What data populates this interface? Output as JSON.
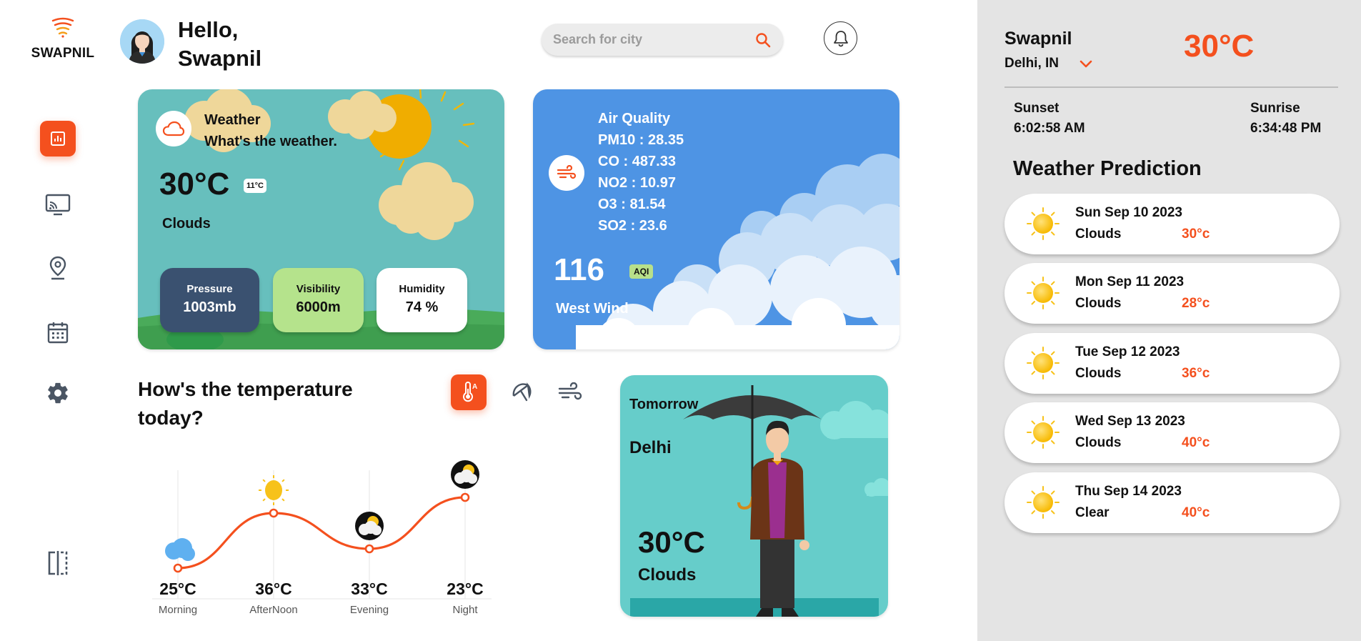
{
  "brand": {
    "name": "SWAPNIL"
  },
  "header": {
    "greeting_line1": "Hello,",
    "greeting_line2": "Swapnil",
    "search_placeholder": "Search for city"
  },
  "sidebar": {
    "items": [
      {
        "icon": "chart-icon",
        "active": true
      },
      {
        "icon": "cast-icon",
        "active": false
      },
      {
        "icon": "location-pin-icon",
        "active": false
      },
      {
        "icon": "calendar-icon",
        "active": false
      },
      {
        "icon": "gear-icon",
        "active": false
      }
    ],
    "bottom_icon": "split-panel-icon"
  },
  "weather_card": {
    "title": "Weather",
    "subtitle": "What's the weather.",
    "temp": "30°C",
    "min_temp": "11°C",
    "condition": "Clouds",
    "stats": [
      {
        "label": "Pressure",
        "value": "1003mb"
      },
      {
        "label": "Visibility",
        "value": "6000m"
      },
      {
        "label": "Humidity",
        "value": "74 %"
      }
    ]
  },
  "air_card": {
    "title": "Air Quality",
    "lines": [
      "PM10 : 28.35",
      "CO : 487.33",
      "NO2 : 10.97",
      "O3 : 81.54",
      "SO2 : 23.6"
    ],
    "aqi_value": "116",
    "aqi_label": "AQI",
    "wind": "West Wind"
  },
  "temperature_section": {
    "title_line1": "How's the temperature",
    "title_line2": "today?",
    "tabs": [
      "thermometer-icon",
      "umbrella-icon",
      "wind-icon"
    ]
  },
  "chart_data": {
    "type": "line",
    "categories": [
      "Morning",
      "AfterNoon",
      "Evening",
      "Night"
    ],
    "values": [
      25,
      36,
      33,
      23
    ],
    "value_labels": [
      "25°C",
      "36°C",
      "33°C",
      "23°C"
    ],
    "icons": [
      "cloud-icon",
      "sun-icon",
      "night-cloud-icon",
      "night-cloud-icon"
    ],
    "grid": true,
    "color": "#f4501e"
  },
  "tomorrow_card": {
    "label": "Tomorrow",
    "city": "Delhi",
    "temp": "30°C",
    "condition": "Clouds"
  },
  "right_panel": {
    "name": "Swapnil",
    "location": "Delhi, IN",
    "temp": "30°C",
    "sunset_label": "Sunset",
    "sunset_time": "6:02:58 AM",
    "sunrise_label": "Sunrise",
    "sunrise_time": "6:34:48 PM",
    "prediction_title": "Weather Prediction",
    "predictions": [
      {
        "date": "Sun Sep 10 2023",
        "condition": "Clouds",
        "temp": "30°c"
      },
      {
        "date": "Mon Sep 11 2023",
        "condition": "Clouds",
        "temp": "28°c"
      },
      {
        "date": "Tue Sep 12 2023",
        "condition": "Clouds",
        "temp": "36°c"
      },
      {
        "date": "Wed Sep 13 2023",
        "condition": "Clouds",
        "temp": "40°c"
      },
      {
        "date": "Thu Sep 14 2023",
        "condition": "Clear",
        "temp": "40°c"
      }
    ]
  },
  "colors": {
    "accent": "#f4501e",
    "weather_card_bg": "#67bfbd",
    "air_card_bg": "#4e94e4",
    "tomorrow_card_bg": "#66cdca",
    "right_panel_bg": "#e4e4e4"
  }
}
